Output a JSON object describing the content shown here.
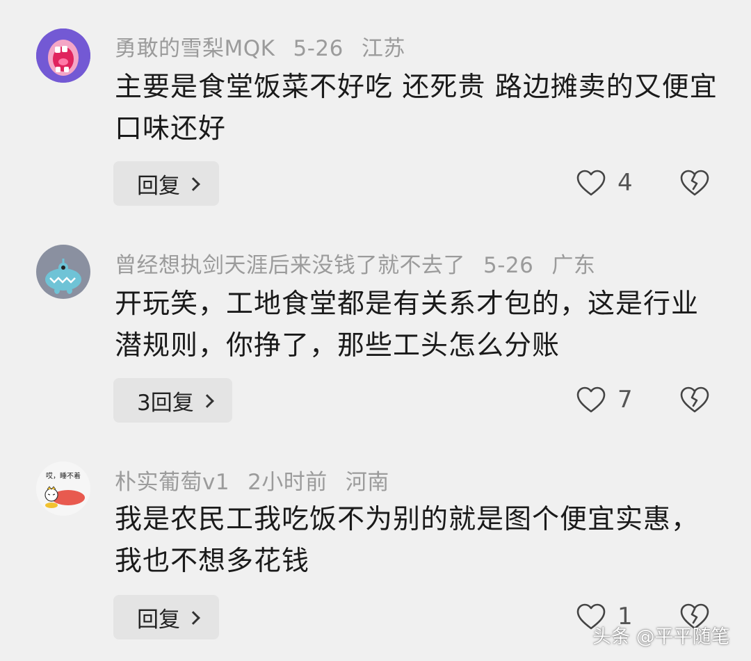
{
  "comments": [
    {
      "username": "勇敢的雪梨MQK",
      "date": "5-26",
      "location": "江苏",
      "text": "主要是食堂饭菜不好吃 还死贵 路边摊卖的又便宜 口味还好",
      "reply_label": "回复",
      "likes": "4",
      "avatar_icon": "screaming-mouth-avatar-icon"
    },
    {
      "username": "曾经想执剑天涯后来没钱了就不去了",
      "date": "5-26",
      "location": "广东",
      "text": "开玩笑，工地食堂都是有关系才包的，这是行业潜规则，你挣了，那些工头怎么分账",
      "reply_label": "3回复",
      "likes": "7",
      "avatar_icon": "blue-monster-avatar-icon"
    },
    {
      "username": "朴实葡萄v1",
      "date": "2小时前",
      "location": "河南",
      "text": "我是农民工我吃饭不为别的就是图个便宜实惠，我也不想多花钱",
      "reply_label": "回复",
      "likes": "1",
      "avatar_icon": "sleepy-cartoon-avatar-icon",
      "avatar_caption": "哎，睡不着"
    }
  ],
  "watermark": "头条 @平平随笔",
  "colors": {
    "background": "#f0f0f0",
    "meta_text": "#9b9b9b",
    "body_text": "#1a1a1a",
    "reply_bg": "#e4e4e4"
  }
}
